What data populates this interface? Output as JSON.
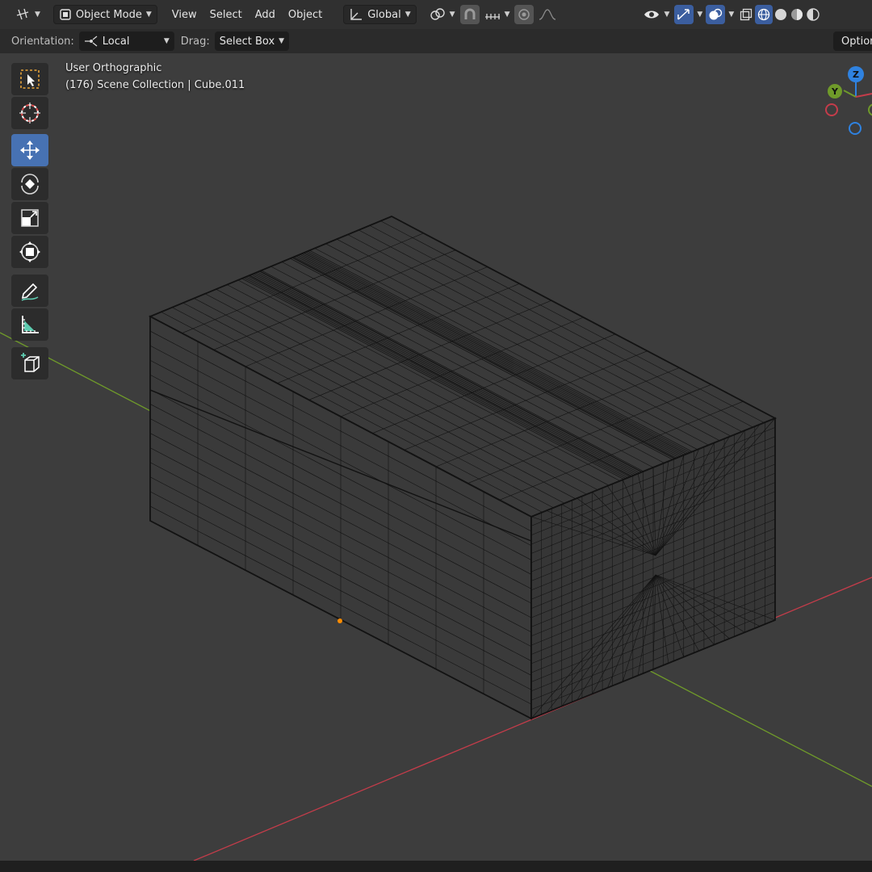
{
  "header": {
    "mode_label": "Object Mode",
    "menus": [
      "View",
      "Select",
      "Add",
      "Object"
    ],
    "transform_orientation": "Global"
  },
  "tool_settings": {
    "orientation_label": "Orientation:",
    "orientation_value": "Local",
    "drag_label": "Drag:",
    "drag_value": "Select Box",
    "options_label": "Options"
  },
  "viewport": {
    "view_name": "User Orthographic",
    "collection_info": "(176) Scene Collection | Cube.011"
  },
  "gizmo": {
    "axes": [
      "Z",
      "Y"
    ]
  },
  "toolbar": {
    "tools": [
      "select-box-tool",
      "cursor-tool",
      "move-tool",
      "rotate-tool",
      "scale-tool",
      "transform-tool",
      "annotate-tool",
      "measure-tool",
      "add-cube-tool"
    ],
    "active_tool": "move-tool"
  },
  "colors": {
    "background": "#3d3d3d",
    "header": "#303030",
    "active_tool": "#4772b3",
    "x_axis": "#c43c4a",
    "y_axis": "#6f9a2a",
    "z_axis": "#2f82e0",
    "wireframe": "#121212",
    "origin": "#ff8c00"
  }
}
